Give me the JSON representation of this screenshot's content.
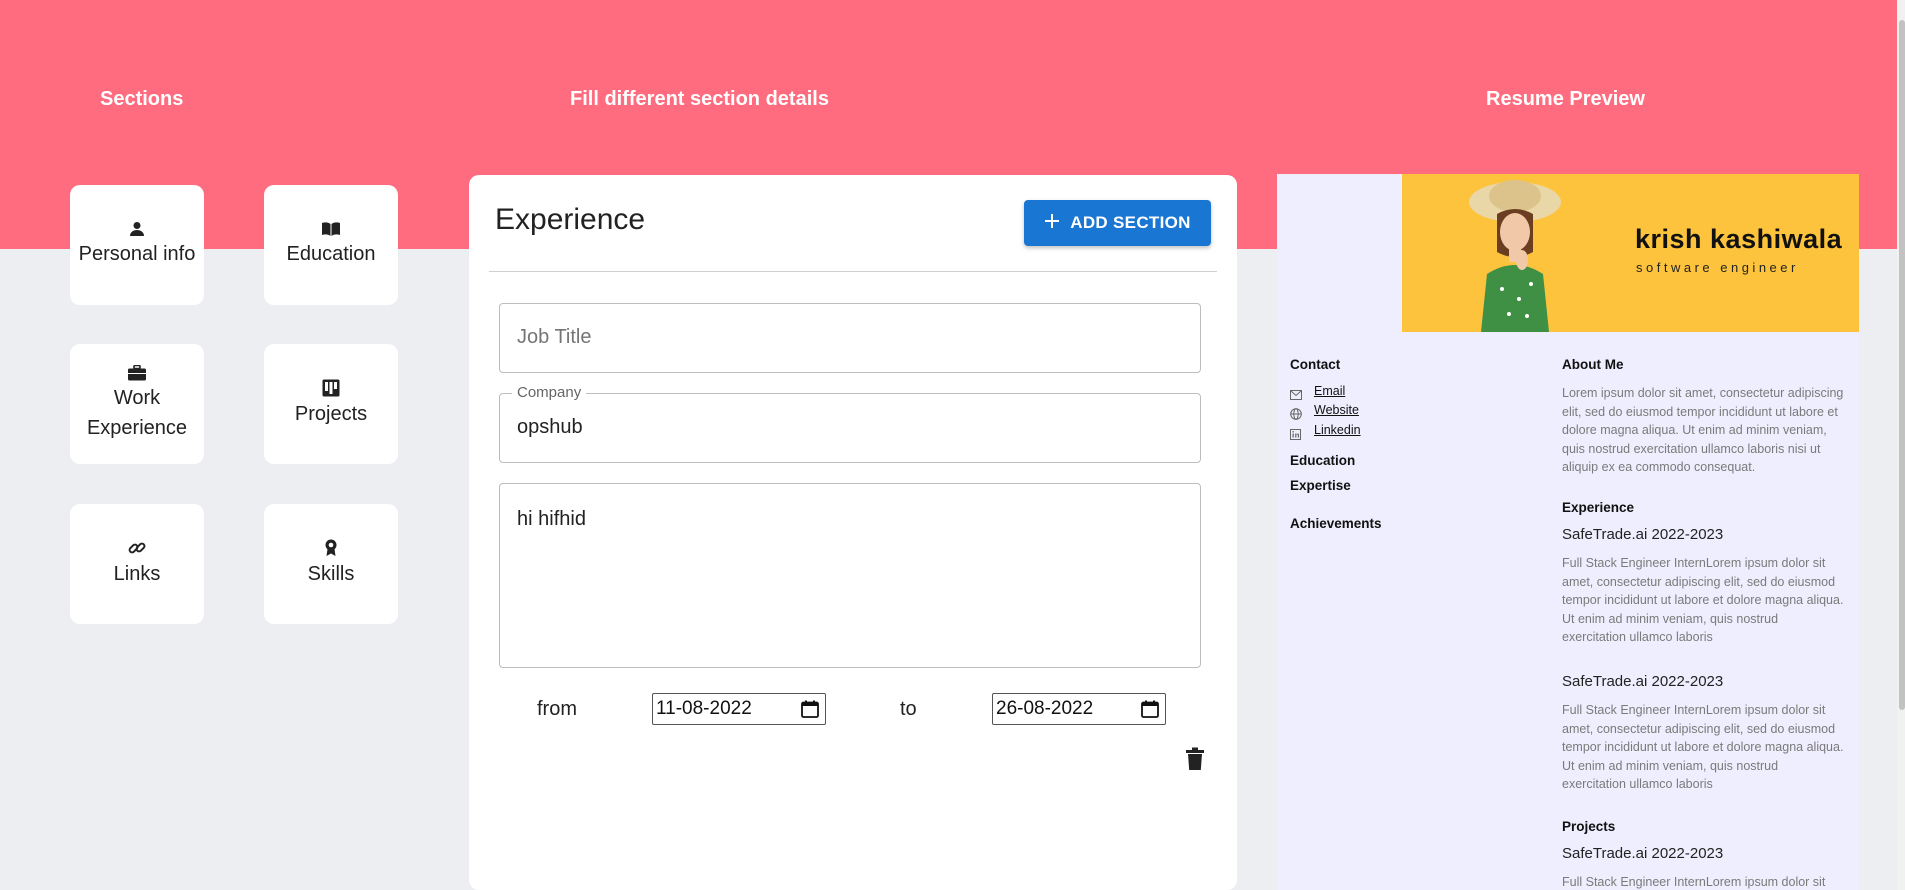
{
  "headers": {
    "sections": "Sections",
    "fill": "Fill different section details",
    "preview": "Resume Preview"
  },
  "sections": [
    {
      "label": "Personal info",
      "icon": "person-icon"
    },
    {
      "label": "Education",
      "icon": "book-icon"
    },
    {
      "label": "Work Experience",
      "line1": "Work",
      "line2": "Experience",
      "icon": "briefcase-icon"
    },
    {
      "label": "Projects",
      "icon": "projects-icon"
    },
    {
      "label": "Links",
      "icon": "link-icon"
    },
    {
      "label": "Skills",
      "icon": "award-icon"
    }
  ],
  "form": {
    "title": "Experience",
    "add_button": "ADD SECTION",
    "job_title_placeholder": "Job Title",
    "company_label": "Company",
    "company_value": "opshub",
    "description_value": "hi hifhid",
    "from_label": "from",
    "from_date": "11-08-2022",
    "to_label": "to",
    "to_date": "26-08-2022"
  },
  "resume": {
    "name": "krish kashiwala",
    "role": "software engineer",
    "contact_heading": "Contact",
    "contact_links": [
      "Email",
      "Website",
      "Linkedin"
    ],
    "left_headings": [
      "Education",
      "Expertise",
      "Achievements"
    ],
    "about_heading": "About Me",
    "about_text": "Lorem ipsum dolor sit amet, consectetur adipiscing elit, sed do eiusmod tempor incididunt ut labore et dolore magna aliqua. Ut enim ad minim veniam, quis nostrud exercitation ullamco laboris nisi ut aliquip ex ea commodo consequat.",
    "experience_heading": "Experience",
    "jobs": [
      {
        "title": "SafeTrade.ai 2022-2023",
        "text": "Full Stack Engineer InternLorem ipsum dolor sit amet, consectetur adipiscing elit, sed do eiusmod tempor incididunt ut labore et dolore magna aliqua. Ut enim ad minim veniam, quis nostrud exercitation ullamco laboris"
      },
      {
        "title": "SafeTrade.ai 2022-2023",
        "text": "Full Stack Engineer InternLorem ipsum dolor sit amet, consectetur adipiscing elit, sed do eiusmod tempor incididunt ut labore et dolore magna aliqua. Ut enim ad minim veniam, quis nostrud exercitation ullamco laboris"
      }
    ],
    "projects_heading": "Projects",
    "projects": [
      {
        "title": "SafeTrade.ai 2022-2023",
        "text": "Full Stack Engineer InternLorem ipsum dolor sit"
      }
    ]
  },
  "colors": {
    "header_band": "#ff6b7f",
    "page_bg": "#edeef2",
    "accent_button": "#1976d2",
    "resume_bg": "#efeefe",
    "banner": "#fdc33c"
  }
}
